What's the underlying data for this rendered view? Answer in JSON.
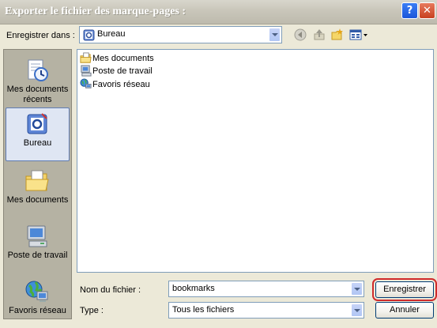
{
  "window": {
    "title": "Exporter le fichier des marque-pages :",
    "help": "?",
    "close": "✕"
  },
  "save_in": {
    "label": "Enregistrer dans :",
    "value": "Bureau"
  },
  "toolbar": {
    "icons": [
      "back-icon",
      "up-folder-icon",
      "new-folder-icon",
      "view-menu-icon"
    ]
  },
  "places": [
    {
      "label": "Mes documents récents",
      "icon": "recent-documents-icon"
    },
    {
      "label": "Bureau",
      "icon": "desktop-icon",
      "selected": true
    },
    {
      "label": "Mes documents",
      "icon": "my-documents-icon"
    },
    {
      "label": "Poste de travail",
      "icon": "my-computer-icon"
    },
    {
      "label": "Favoris réseau",
      "icon": "network-places-icon"
    }
  ],
  "files": [
    {
      "name": "Mes documents",
      "icon": "my-documents-icon"
    },
    {
      "name": "Poste de travail",
      "icon": "my-computer-icon"
    },
    {
      "name": "Favoris réseau",
      "icon": "network-places-icon"
    }
  ],
  "filename": {
    "label": "Nom du fichier :",
    "value": "bookmarks"
  },
  "filetype": {
    "label": "Type :",
    "value": "Tous les fichiers"
  },
  "buttons": {
    "save": "Enregistrer",
    "cancel": "Annuler"
  },
  "colors": {
    "title_text": "#ffffff",
    "selection": "#dfe6f3",
    "focus_outline": "#d02b2b"
  }
}
